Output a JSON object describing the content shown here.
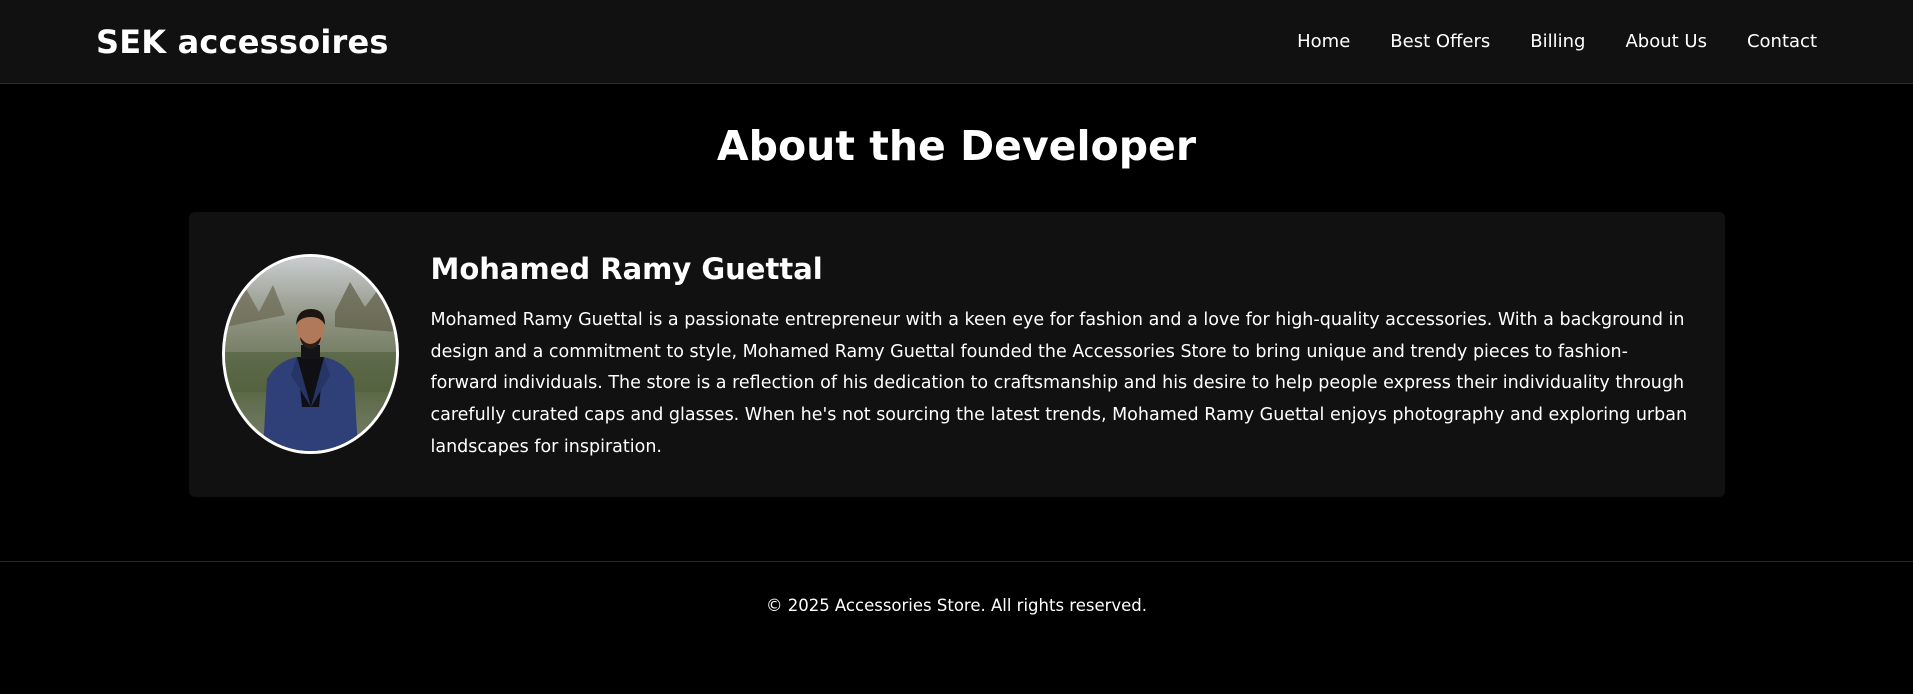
{
  "navbar": {
    "brand": "SEK accessoires",
    "links": [
      "Home",
      "Best Offers",
      "Billing",
      "About Us",
      "Contact"
    ]
  },
  "main": {
    "title": "About the Developer",
    "developer": {
      "name": "Mohamed Ramy Guettal",
      "description": "Mohamed Ramy Guettal is a passionate entrepreneur with a keen eye for fashion and a love for high-quality accessories. With a background in design and a commitment to style, Mohamed Ramy Guettal founded the Accessories Store to bring unique and trendy pieces to fashion-forward individuals. The store is a reflection of his dedication to craftsmanship and his desire to help people express their individuality through carefully curated caps and glasses. When he's not sourcing the latest trends, Mohamed Ramy Guettal enjoys photography and exploring urban landscapes for inspiration."
    }
  },
  "footer": {
    "copyright": "© 2025 Accessories Store. All rights reserved."
  },
  "colors": {
    "background": "#000000",
    "navbar": "#111111",
    "card": "#111111",
    "text": "#ffffff",
    "divider": "#2a2a2a"
  }
}
